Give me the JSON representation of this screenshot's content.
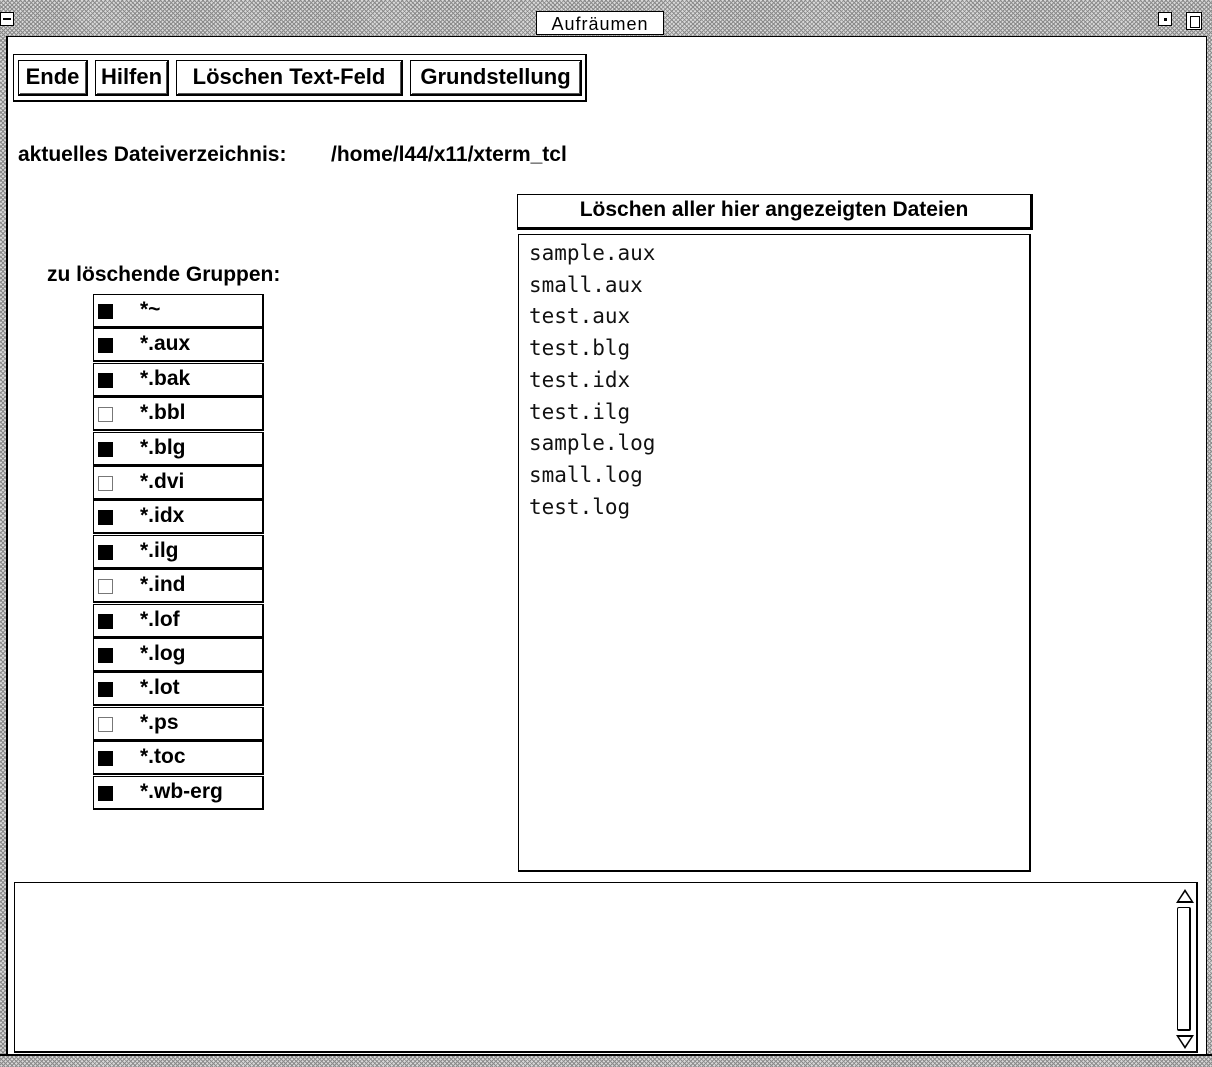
{
  "window": {
    "title": "Aufräumen"
  },
  "toolbar": {
    "buttons": [
      {
        "label": "Ende"
      },
      {
        "label": "Hilfen"
      },
      {
        "label": "Löschen Text-Feld"
      },
      {
        "label": "Grundstellung"
      }
    ]
  },
  "directory": {
    "label": "aktuelles Dateiverzeichnis:",
    "path": "/home/l44/x11/xterm_tcl"
  },
  "groups": {
    "heading": "zu löschende Gruppen:",
    "items": [
      {
        "label": "*~",
        "checked": true
      },
      {
        "label": "*.aux",
        "checked": true
      },
      {
        "label": "*.bak",
        "checked": true
      },
      {
        "label": "*.bbl",
        "checked": false
      },
      {
        "label": "*.blg",
        "checked": true
      },
      {
        "label": "*.dvi",
        "checked": false
      },
      {
        "label": "*.idx",
        "checked": true
      },
      {
        "label": "*.ilg",
        "checked": true
      },
      {
        "label": "*.ind",
        "checked": false
      },
      {
        "label": "*.lof",
        "checked": true
      },
      {
        "label": "*.log",
        "checked": true
      },
      {
        "label": "*.lot",
        "checked": true
      },
      {
        "label": "*.ps",
        "checked": false
      },
      {
        "label": "*.toc",
        "checked": true
      },
      {
        "label": "*.wb-erg",
        "checked": true
      }
    ]
  },
  "files": {
    "delete_all_label": "Löschen aller hier angezeigten Dateien",
    "items": [
      "sample.aux",
      "small.aux",
      "test.aux",
      "test.blg",
      "test.idx",
      "test.ilg",
      "sample.log",
      "small.log",
      "test.log"
    ]
  },
  "output": {
    "text": ""
  }
}
